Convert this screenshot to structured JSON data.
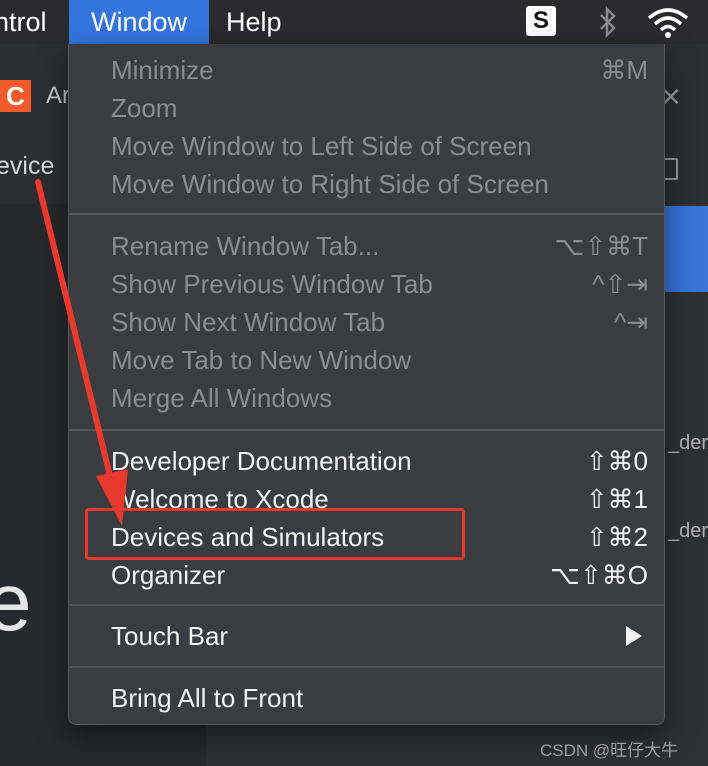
{
  "menubar": {
    "control_label": "ntrol",
    "window_label": "Window",
    "help_label": "Help",
    "status_icon_letter": "S"
  },
  "background": {
    "logo_letter": "C",
    "tab_text": "Ar",
    "close_glyph": "✕",
    "device_text": "evice",
    "right_label_1": "_der",
    "right_label_2": "_der",
    "big_letter": "e"
  },
  "menu": {
    "group1": [
      {
        "label": "Minimize",
        "shortcut": "⌘M",
        "enabled": false
      },
      {
        "label": "Zoom",
        "shortcut": "",
        "enabled": false
      },
      {
        "label": "Move Window to Left Side of Screen",
        "shortcut": "",
        "enabled": false
      },
      {
        "label": "Move Window to Right Side of Screen",
        "shortcut": "",
        "enabled": false
      }
    ],
    "group2": [
      {
        "label": "Rename Window Tab...",
        "shortcut": "⌥⇧⌘T",
        "enabled": false
      },
      {
        "label": "Show Previous Window Tab",
        "shortcut": "^⇧⇥",
        "enabled": false
      },
      {
        "label": "Show Next Window Tab",
        "shortcut": "^⇥",
        "enabled": false
      },
      {
        "label": "Move Tab to New Window",
        "shortcut": "",
        "enabled": false
      },
      {
        "label": "Merge All Windows",
        "shortcut": "",
        "enabled": false
      }
    ],
    "group3": [
      {
        "label": "Developer Documentation",
        "shortcut": "⇧⌘0",
        "enabled": true
      },
      {
        "label": "Welcome to Xcode",
        "shortcut": "⇧⌘1",
        "enabled": true
      },
      {
        "label": "Devices and Simulators",
        "shortcut": "⇧⌘2",
        "enabled": true
      },
      {
        "label": "Organizer",
        "shortcut": "⌥⇧⌘O",
        "enabled": true
      }
    ],
    "group4": [
      {
        "label": "Touch Bar",
        "shortcut": "",
        "enabled": true
      }
    ],
    "group5": [
      {
        "label": "Bring All to Front",
        "shortcut": "",
        "enabled": true
      }
    ]
  },
  "watermark": "CSDN @旺仔大牛",
  "colors": {
    "highlight_accent": "#3476de",
    "annotation_red": "#e8392f"
  }
}
